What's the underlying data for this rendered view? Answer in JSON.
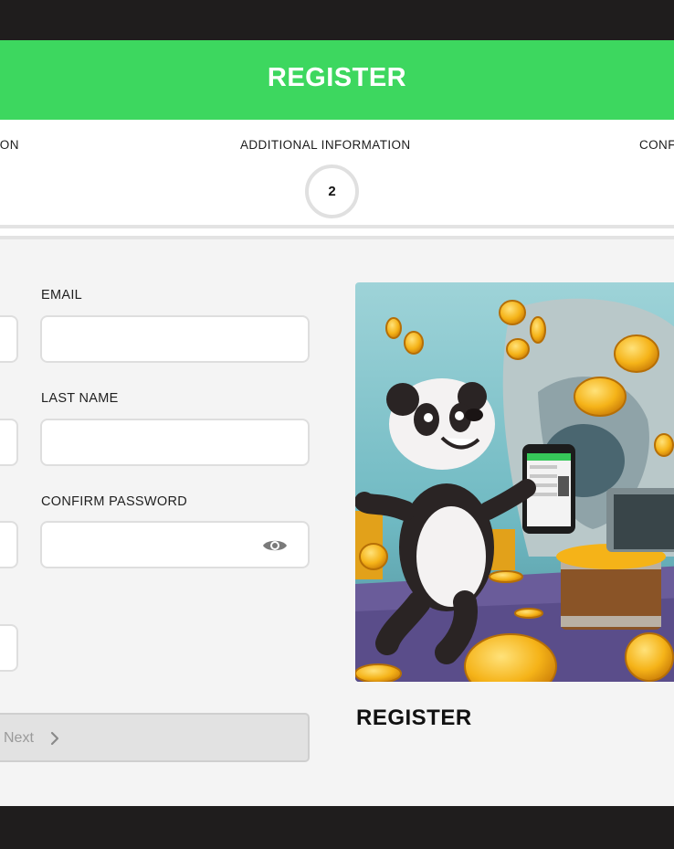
{
  "header": {
    "title": "REGISTER"
  },
  "steps": [
    {
      "label": "PERSONAL INFORMATION",
      "visible_text": "TION"
    },
    {
      "label": "ADDITIONAL INFORMATION",
      "number": "2"
    },
    {
      "label": "CONFIRMATION",
      "visible_text": "CONF"
    }
  ],
  "form": {
    "email_label": "EMAIL",
    "last_name_label": "LAST NAME",
    "confirm_password_label": "CONFIRM PASSWORD",
    "email_value": "",
    "last_name_value": "",
    "confirm_password_value": "",
    "next_label": "Next"
  },
  "sidebar": {
    "title": "REGISTER",
    "image": "panda-with-phone-and-gold-coins"
  },
  "colors": {
    "accent": "#3dd75f",
    "background": "#f4f4f4",
    "frame": "#1f1d1d"
  }
}
